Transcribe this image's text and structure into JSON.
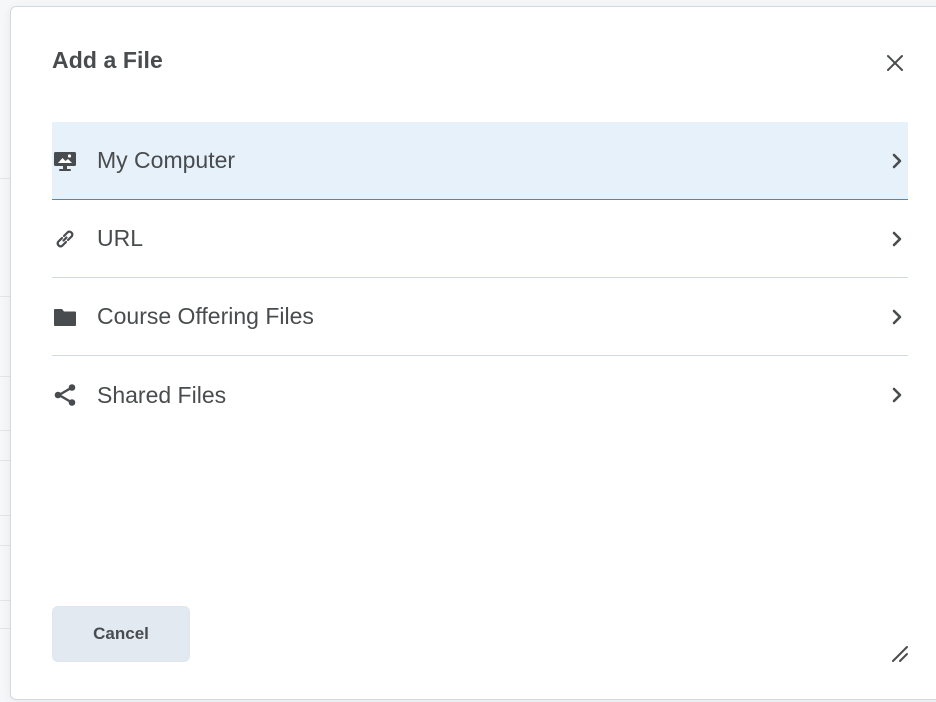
{
  "dialog": {
    "title": "Add a File",
    "close_icon": "close-icon"
  },
  "sources": [
    {
      "label": "My Computer",
      "icon": "computer-upload-icon",
      "selected": true
    },
    {
      "label": "URL",
      "icon": "link-icon",
      "selected": false
    },
    {
      "label": "Course Offering Files",
      "icon": "folder-icon",
      "selected": false
    },
    {
      "label": "Shared Files",
      "icon": "share-icon",
      "selected": false
    }
  ],
  "footer": {
    "cancel_label": "Cancel",
    "resize_icon": "resize-handle-icon"
  },
  "colors": {
    "text": "#494c4e",
    "selected_bg": "#e6f1f9",
    "selected_border": "#3b8fd1",
    "divider": "#d3d9e3",
    "button_bg": "#e3e9f1"
  }
}
